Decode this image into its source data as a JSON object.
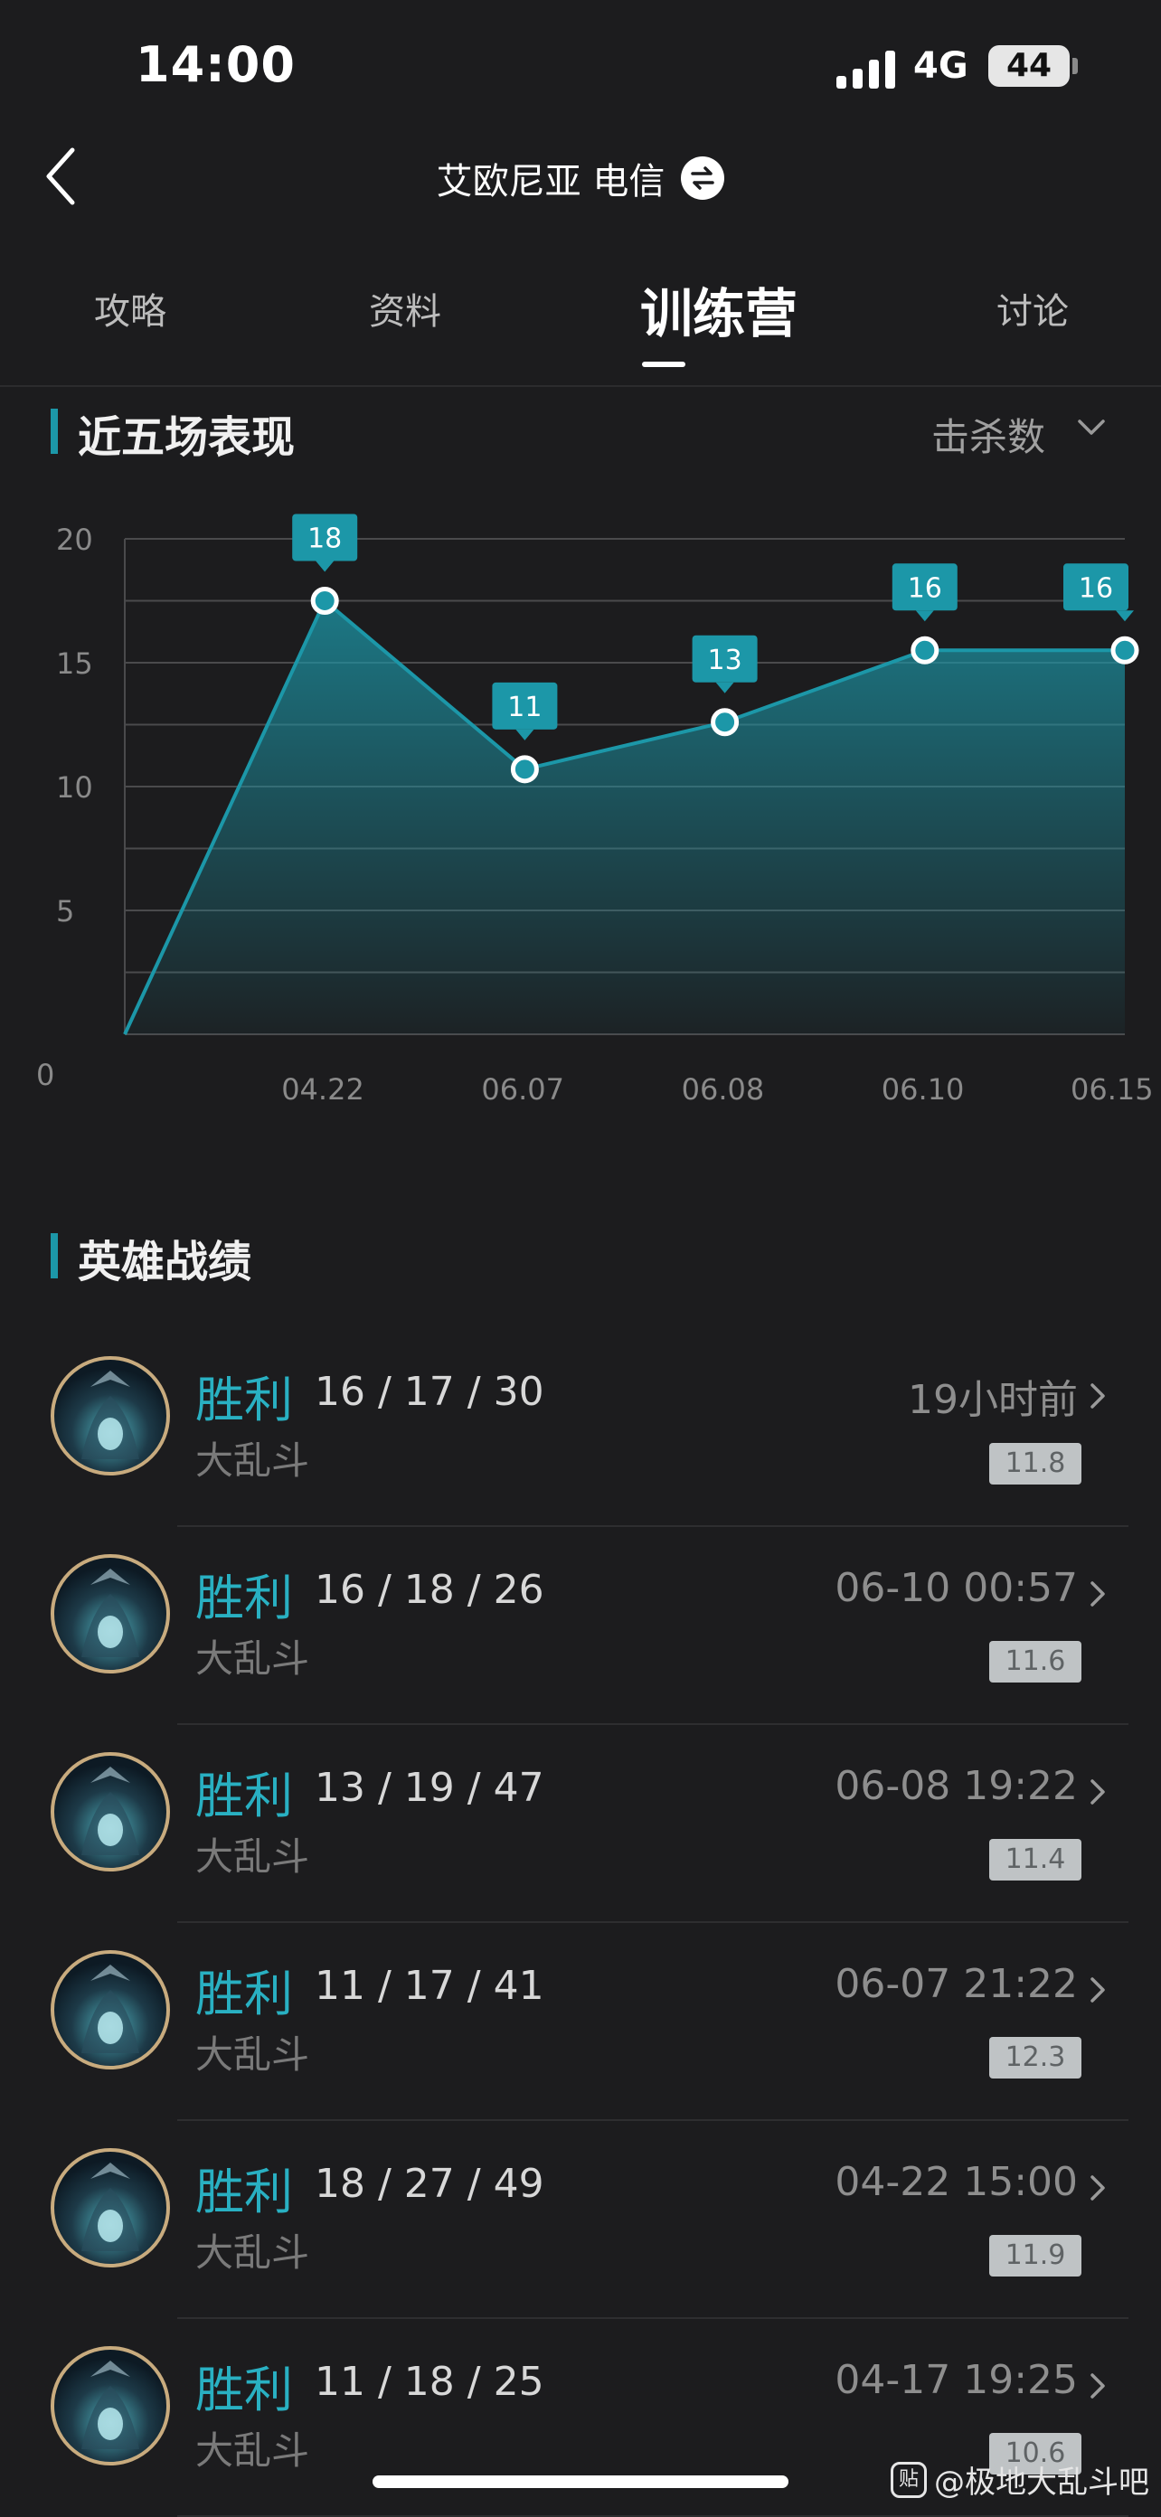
{
  "status_bar": {
    "time": "14:00",
    "network": "4G",
    "battery": "44"
  },
  "header": {
    "title": "艾欧尼亚 电信"
  },
  "tabs": [
    {
      "label": "攻略",
      "active": false
    },
    {
      "label": "资料",
      "active": false
    },
    {
      "label": "训练营",
      "active": true
    },
    {
      "label": "讨论",
      "active": false
    }
  ],
  "performance": {
    "title": "近五场表现",
    "metric_label": "击杀数"
  },
  "chart_data": {
    "type": "area",
    "title": "近五场表现",
    "x": [
      "",
      "04.22",
      "06.07",
      "06.08",
      "06.10",
      "06.15"
    ],
    "y_axis_ticks": [
      0,
      5,
      10,
      15,
      20
    ],
    "ylim": [
      0,
      20
    ],
    "values": [
      0,
      17.5,
      10.7,
      12.6,
      15.5,
      15.5
    ],
    "point_labels": [
      "",
      "18",
      "11",
      "13",
      "16",
      "16"
    ],
    "grid": true,
    "color": "#1c97a8"
  },
  "hero_records": {
    "title": "英雄战绩",
    "items": [
      {
        "result": "胜利",
        "kda": "16 / 17 / 30",
        "mode": "大乱斗",
        "time": "19小时前",
        "score": "11.8"
      },
      {
        "result": "胜利",
        "kda": "16 / 18 / 26",
        "mode": "大乱斗",
        "time": "06-10 00:57",
        "score": "11.6"
      },
      {
        "result": "胜利",
        "kda": "13 / 19 / 47",
        "mode": "大乱斗",
        "time": "06-08 19:22",
        "score": "11.4"
      },
      {
        "result": "胜利",
        "kda": "11 / 17 / 41",
        "mode": "大乱斗",
        "time": "06-07 21:22",
        "score": "12.3"
      },
      {
        "result": "胜利",
        "kda": "18 / 27 / 49",
        "mode": "大乱斗",
        "time": "04-22 15:00",
        "score": "11.9"
      },
      {
        "result": "胜利",
        "kda": "11 / 18 / 25",
        "mode": "大乱斗",
        "time": "04-17 19:25",
        "score": "10.6"
      }
    ]
  },
  "watermark": {
    "logo": "贴",
    "text": "@极地大乱斗吧"
  },
  "colors": {
    "accent": "#1c97a8",
    "win": "#29b0c2",
    "background": "#1c1c1e"
  }
}
